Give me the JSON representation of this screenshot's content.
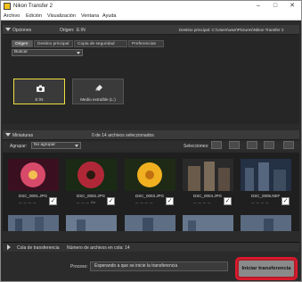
{
  "app": {
    "title": "Nikon Transfer 2"
  },
  "menu": [
    "Archivo",
    "Edición",
    "Visualización",
    "Ventana",
    "Ayuda"
  ],
  "options": {
    "header": "Opciones",
    "origin_label": "Origen:",
    "origin_value": "E:\\N",
    "destination_text": "Destino principal: C:\\Users\\user\\Pictures\\Nikon Transfer 2",
    "tabs": [
      "Origen",
      "Destino principal",
      "Copia de seguridad",
      "Preferencias"
    ],
    "search_value": "Buscar",
    "sources": [
      {
        "icon": "camera-icon",
        "label": "E:\\N",
        "selected": true
      },
      {
        "icon": "removable-media-icon",
        "label": "Medio extraíble (L:)",
        "selected": false
      }
    ]
  },
  "thumbnails": {
    "header": "Miniaturas",
    "count_text": "0 de 14 archivos seleccionados",
    "group_label": "Agrupar:",
    "group_value": "No agrupar",
    "select_label": "Selecciones:",
    "items": [
      {
        "name": "DSC_0001.JPG",
        "color": "#c8405a",
        "meta": "— — — —",
        "checked": true
      },
      {
        "name": "DSC_0002.JPG",
        "color": "#b02a3a",
        "meta": "— — — On",
        "checked": true
      },
      {
        "name": "DSC_0003.JPG",
        "color": "#e0a020",
        "meta": "— — — —",
        "checked": true
      },
      {
        "name": "DSC_0004.JPG",
        "color": "#6a5a4a",
        "meta": "— — — —",
        "checked": true
      },
      {
        "name": "DSC_0005.NEF",
        "color": "#4a5a70",
        "meta": "— — — —",
        "checked": true
      }
    ]
  },
  "queue": {
    "label": "Cola de transferencia",
    "count_text": "Número de archivos en cola: 14"
  },
  "process": {
    "label": "Proceso:",
    "status": "Esperando a que se inicie la transferencia"
  },
  "start_button": "Iniciar transferencia",
  "colors": {
    "accent_red": "#e0182d",
    "selected_border": "#f0e040"
  }
}
